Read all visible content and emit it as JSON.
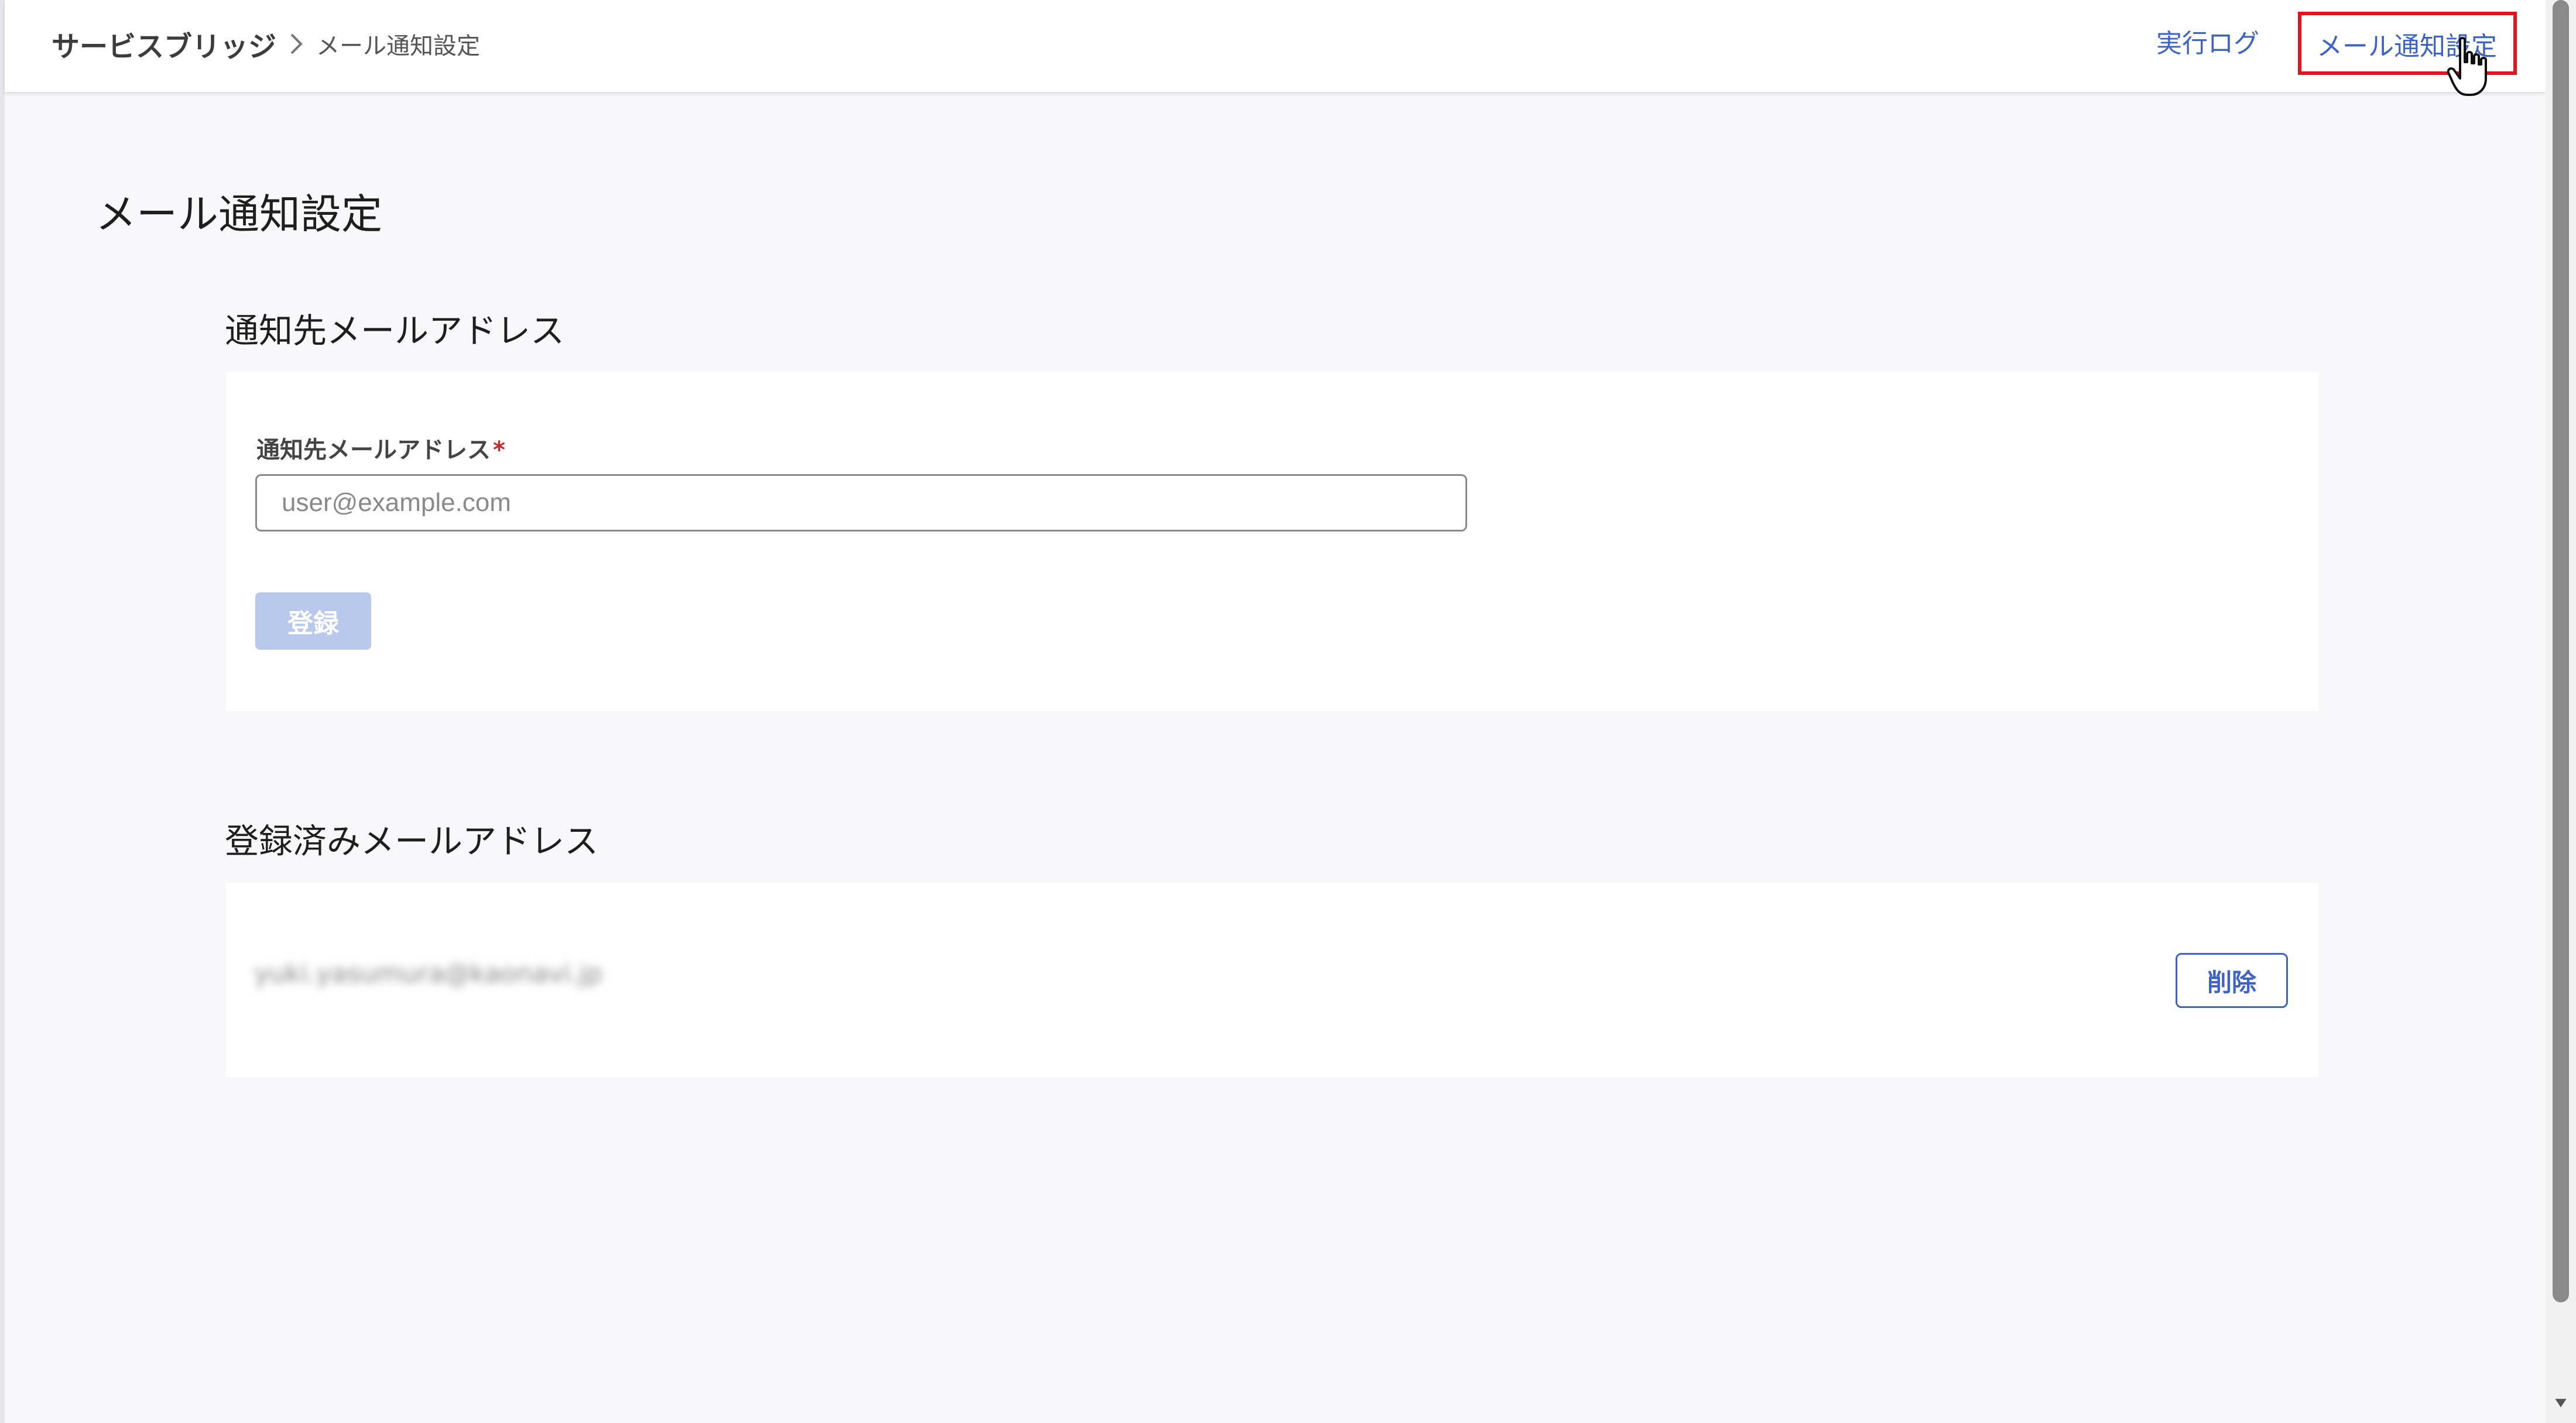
{
  "header": {
    "breadcrumb": {
      "app": "サービスブリッジ",
      "current": "メール通知設定"
    },
    "nav": {
      "execution_log": "実行ログ",
      "mail_settings": "メール通知設定"
    }
  },
  "page": {
    "title": "メール通知設定"
  },
  "notify_section": {
    "title": "通知先メールアドレス",
    "field_label": "通知先メールアドレス",
    "required_mark": "*",
    "input_value": "",
    "input_placeholder": "user@example.com",
    "submit_label": "登録"
  },
  "registered_section": {
    "title": "登録済みメールアドレス",
    "items": [
      {
        "email": "yuki.yasumura@kaonavi.jp",
        "delete_label": "削除"
      }
    ]
  },
  "icons": {
    "breadcrumb_separator": "chevron-right-icon",
    "cursor": "hand-pointer-icon"
  },
  "colors": {
    "accent": "#3d63c4",
    "highlight_box": "#e3141c",
    "disabled_button": "#b9c9ec",
    "required": "#c62828"
  }
}
